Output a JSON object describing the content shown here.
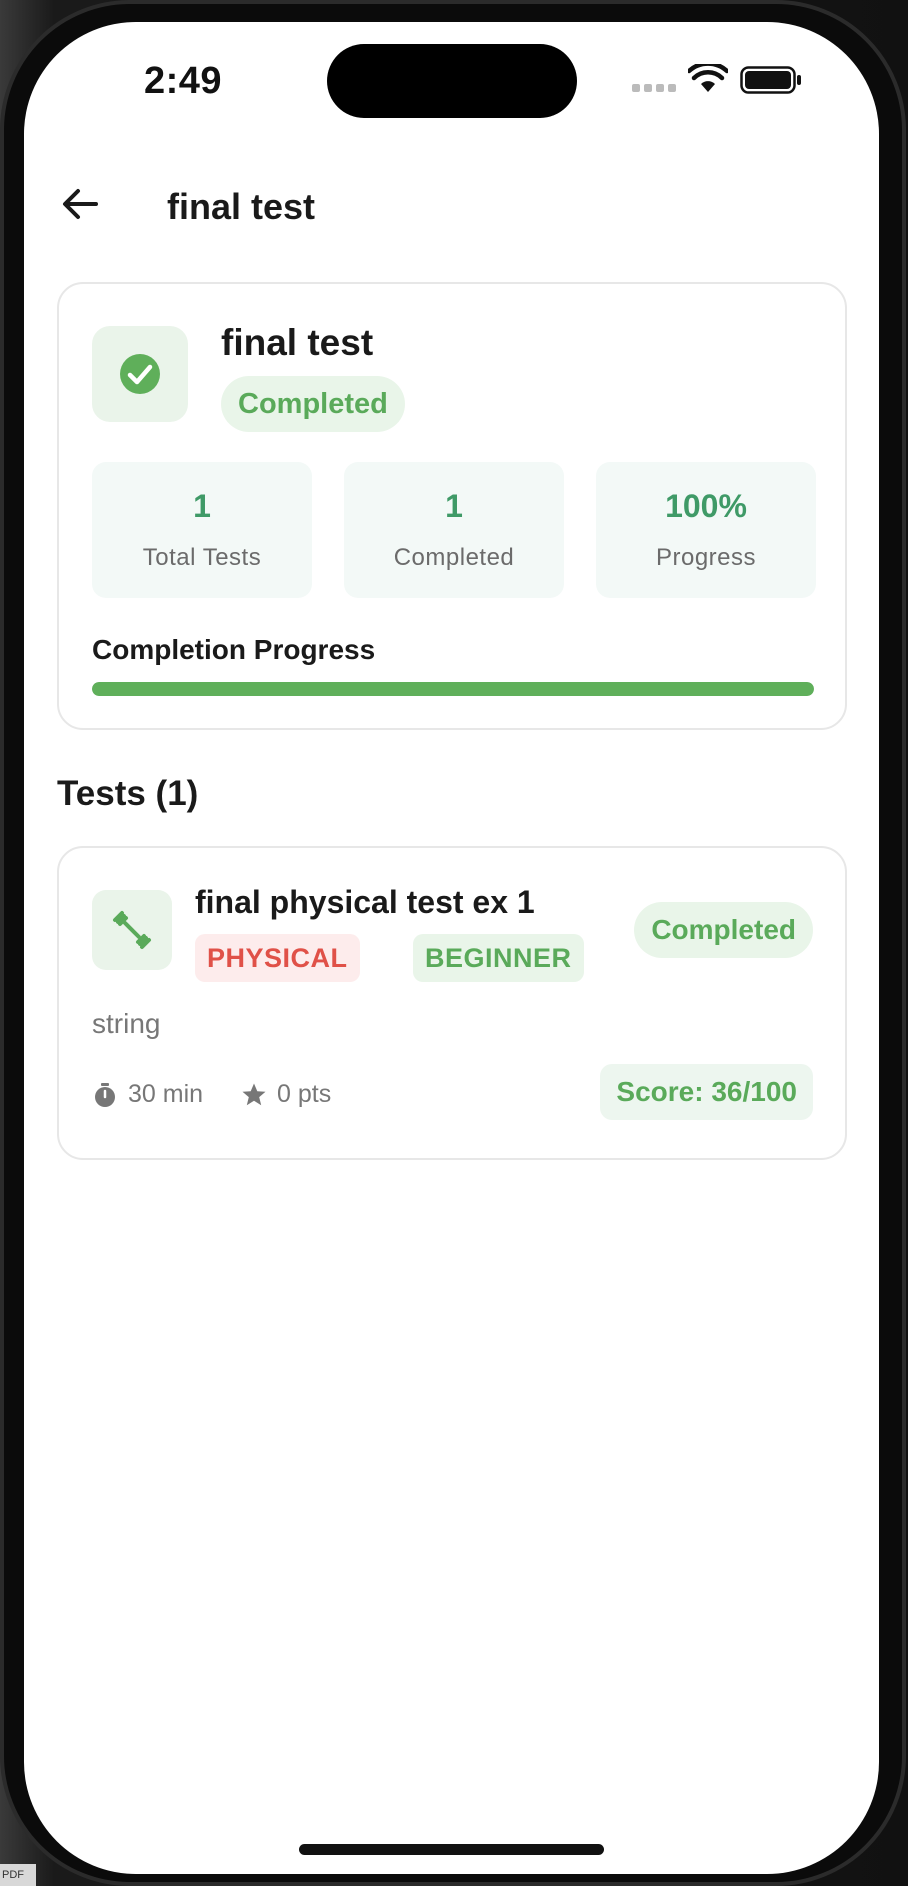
{
  "status_bar": {
    "time": "2:49"
  },
  "header": {
    "title": "final test"
  },
  "summary": {
    "title": "final test",
    "status": "Completed",
    "stats": [
      {
        "value": "1",
        "label": "Total Tests"
      },
      {
        "value": "1",
        "label": "Completed"
      },
      {
        "value": "100%",
        "label": "Progress"
      }
    ],
    "progress_label": "Completion Progress",
    "progress_fraction": 1.0
  },
  "tests_section": {
    "title": "Tests (1)"
  },
  "tests": [
    {
      "title": "final physical  test ex 1",
      "category": "PHYSICAL",
      "level": "BEGINNER",
      "status": "Completed",
      "description": "string",
      "duration": "30 min",
      "points": "0 pts",
      "score": "Score: 36/100"
    }
  ],
  "icons": {
    "back": "arrow-left-icon",
    "summary": "check-circle-icon",
    "test": "dumbbell-icon",
    "duration": "timer-icon",
    "points": "star-icon"
  },
  "colors": {
    "accent_green": "#5aaa5a",
    "stat_green": "#3f9a67",
    "tag_red": "#e05148",
    "card_border": "#e7e7e7"
  }
}
